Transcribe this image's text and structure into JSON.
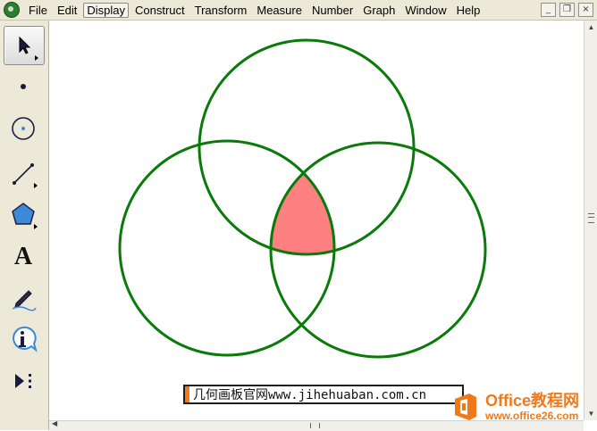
{
  "menu": {
    "items": [
      "File",
      "Edit",
      "Display",
      "Construct",
      "Transform",
      "Measure",
      "Number",
      "Graph",
      "Window",
      "Help"
    ],
    "active": "Display"
  },
  "window_controls": {
    "minimize": "_",
    "restore": "❐",
    "close": "×"
  },
  "toolbox": {
    "tools": [
      {
        "name": "arrow-select-tool",
        "icon": "arrow-icon",
        "selected": true
      },
      {
        "name": "point-tool",
        "icon": "point-icon"
      },
      {
        "name": "compass-tool",
        "icon": "compass-circle-icon"
      },
      {
        "name": "straightedge-tool",
        "icon": "line-segment-icon"
      },
      {
        "name": "polygon-tool",
        "icon": "pentagon-icon"
      },
      {
        "name": "text-tool",
        "icon": "text-a-icon",
        "label": "A"
      },
      {
        "name": "marker-tool",
        "icon": "pen-marker-icon"
      },
      {
        "name": "information-tool",
        "icon": "info-icon",
        "label": "i"
      },
      {
        "name": "custom-tool",
        "icon": "play-custom-icon"
      }
    ]
  },
  "sketch": {
    "circles": [
      {
        "name": "top-circle"
      },
      {
        "name": "left-circle"
      },
      {
        "name": "right-circle"
      }
    ],
    "circle_color": "#0a7a0a",
    "intersection_fill": "#ff8080"
  },
  "caption": {
    "text": "几何画板官网www.jihehuaban.com.cn",
    "accent": "#f07a1a"
  },
  "watermark": {
    "title": "Office教程网",
    "url": "www.office26.com",
    "color": "#f07a1a"
  }
}
